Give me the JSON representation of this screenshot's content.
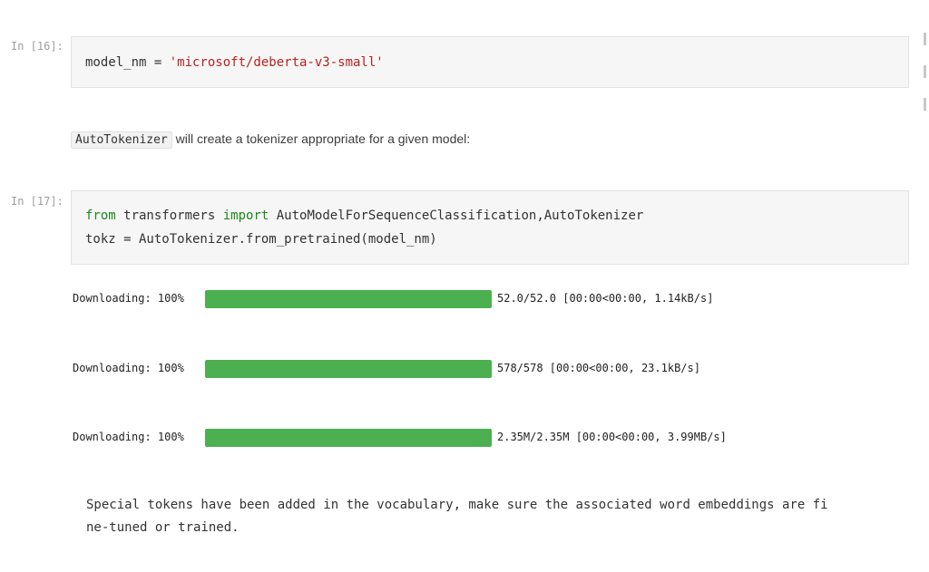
{
  "cells": [
    {
      "prompt": "In [16]:",
      "code_lines": [
        [
          {
            "t": "model_nm = "
          },
          {
            "t": "'microsoft/deberta-v3-small'",
            "c": "str"
          }
        ]
      ]
    },
    {
      "prompt": "In [17]:",
      "code_lines": [
        [
          {
            "t": "from",
            "c": "kw"
          },
          {
            "t": " transformers "
          },
          {
            "t": "import",
            "c": "kw"
          },
          {
            "t": " AutoModelForSequenceClassification,AutoTokenizer"
          }
        ],
        [
          {
            "t": "tokz = AutoTokenizer.from_pretrained(model_nm)"
          }
        ]
      ]
    }
  ],
  "markdown": {
    "inline_code": "AutoTokenizer",
    "text": " will create a tokenizer appropriate for a given model:"
  },
  "downloads": [
    {
      "label": "Downloading: 100%",
      "progress": 1.0,
      "color": "#4caf50",
      "stats": "52.0/52.0 [00:00<00:00, 1.14kB/s]"
    },
    {
      "label": "Downloading: 100%",
      "progress": 1.0,
      "color": "#4caf50",
      "stats": "578/578 [00:00<00:00, 23.1kB/s]"
    },
    {
      "label": "Downloading: 100%",
      "progress": 1.0,
      "color": "#4caf50",
      "stats": "2.35M/2.35M [00:00<00:00, 3.99MB/s]"
    }
  ],
  "stderr_lines": [
    "Special tokens have been added in the vocabulary, make sure the associated word embeddings are fi",
    "ne-tuned or trained."
  ],
  "colors": {
    "keyword": "#1a8a1a",
    "string": "#ba2121",
    "progress": "#4caf50"
  }
}
